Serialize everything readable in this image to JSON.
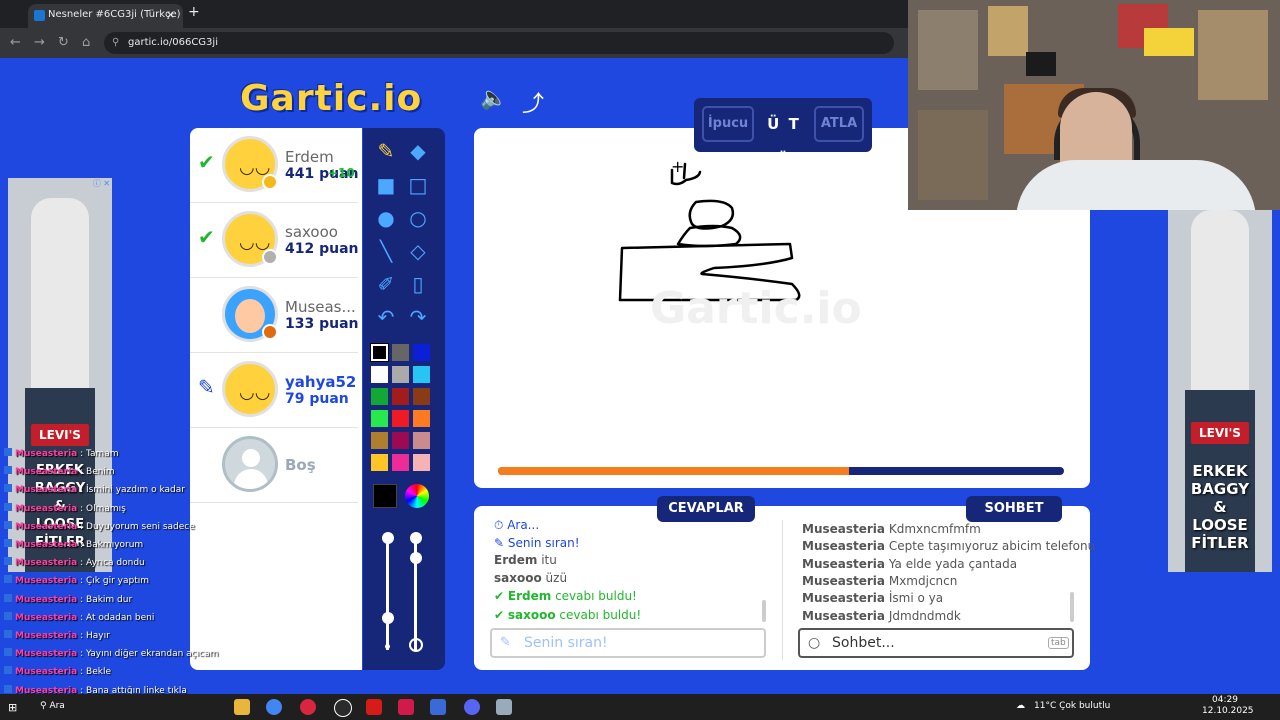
{
  "browser": {
    "tab_title": "Nesneler #6CG3ji (Türkçe)",
    "tab_close": "×",
    "new_tab": "+",
    "url": "gartic.io/066CG3ji",
    "nav": {
      "back": "←",
      "forward": "→",
      "reload": "↻",
      "home": "⌂",
      "lock": "⚲"
    }
  },
  "game": {
    "logo": "Gartic.io",
    "sound_icon": "🔈",
    "share_icon": "⤴",
    "hint": {
      "hint_label": "İpucu",
      "word": "Ü T Ü",
      "skip_label": "ATLA"
    },
    "watermark": "Gartic.io",
    "timer_progress": 0.62,
    "players": [
      {
        "name": "Erdem",
        "score": "441 puan",
        "bonus": "+10",
        "status": "check",
        "dot_color": "#f5b91a"
      },
      {
        "name": "saxooo",
        "score": "412 puan",
        "bonus": "",
        "status": "check",
        "dot_color": "#b0b0b0"
      },
      {
        "name": "Museas...",
        "score": "133 puan",
        "bonus": "",
        "status": "",
        "dot_color": "#e06a10"
      },
      {
        "name": "yahya52",
        "score": "79 puan",
        "bonus": "",
        "status": "drawing",
        "dot_color": ""
      },
      {
        "name": "Boş",
        "score": "",
        "bonus": "",
        "status": "empty",
        "dot_color": ""
      }
    ],
    "tools_icons": [
      "pencil-icon",
      "eraser-icon",
      "filled-rect-icon",
      "rect-icon",
      "filled-circle-icon",
      "circle-icon",
      "line-icon",
      "fill-bucket-icon",
      "eyedropper-icon",
      "page-icon",
      "undo-icon",
      "redo-icon"
    ],
    "palette": [
      "#000000",
      "#666666",
      "#0a1fd6",
      "#ffffff",
      "#aaaaaa",
      "#27c4f4",
      "#11a836",
      "#a31c1c",
      "#8a3a15",
      "#27e84c",
      "#ee1b24",
      "#ff7a21",
      "#b07f2e",
      "#9b0a53",
      "#c98b8b",
      "#ffc526",
      "#ed2c98",
      "#f7b2b5"
    ],
    "answers_tab": "CEVAPLAR",
    "chat_tab": "SOHBET",
    "answers": [
      {
        "user": "",
        "text": "Ara...",
        "type": "blue"
      },
      {
        "user": "",
        "text": "Senin sıran!",
        "type": "blue"
      },
      {
        "user": "Erdem",
        "text": "itu",
        "type": "normal"
      },
      {
        "user": "saxooo",
        "text": "üzü",
        "type": "normal"
      },
      {
        "user": "Erdem",
        "text": "cevabı buldu!",
        "type": "green"
      },
      {
        "user": "saxooo",
        "text": "cevabı buldu!",
        "type": "green"
      }
    ],
    "chat": [
      {
        "user": "Museasteria",
        "text": "Kdmxncmfmfm"
      },
      {
        "user": "Museasteria",
        "text": "Cepte taşımıyoruz abicim telefonu"
      },
      {
        "user": "Museasteria",
        "text": "Ya elde yada çantada"
      },
      {
        "user": "Museasteria",
        "text": "Mxmdjcncn"
      },
      {
        "user": "Museasteria",
        "text": "İsmi o ya"
      },
      {
        "user": "Museasteria",
        "text": "Jdmdndmdk"
      }
    ],
    "answer_placeholder": "Senin sıran!",
    "chat_placeholder": "Sohbet...",
    "tab_key": "tab"
  },
  "ads": {
    "brand": "LEVI'S",
    "copy": [
      "ERKEK",
      "BAGGY",
      "&",
      "LOOSE",
      "FİTLER"
    ],
    "info": "ⓘ ✕"
  },
  "stream_overlay": [
    {
      "user": "Museasteria",
      "text": "Tamam"
    },
    {
      "user": "Museasteria",
      "text": "Benim"
    },
    {
      "user": "Museasteria",
      "text": "İsmini yazdım o kadar"
    },
    {
      "user": "Museasteria",
      "text": "Olmamış"
    },
    {
      "user": "Museasteria",
      "text": "Duyuyorum seni sadece"
    },
    {
      "user": "Museasteria",
      "text": "Bakmıyorum"
    },
    {
      "user": "Museasteria",
      "text": "Ayrıca dondu"
    },
    {
      "user": "Museasteria",
      "text": "Çık gir yaptım"
    },
    {
      "user": "Museasteria",
      "text": "Bakim dur"
    },
    {
      "user": "Museasteria",
      "text": "At odadan beni"
    },
    {
      "user": "Museasteria",
      "text": "Hayır"
    },
    {
      "user": "Museasteria",
      "text": "Yayını diğer ekrandan açıcam"
    },
    {
      "user": "Museasteria",
      "text": "Bekle"
    },
    {
      "user": "Museasteria",
      "text": "Bana attığın linke tıkla"
    },
    {
      "user": "Museasteria",
      "text": "Başka odadasın"
    }
  ],
  "taskbar": {
    "search_label": "Ara",
    "weather": "11°C  Çok bulutlu",
    "time": "04:29",
    "date": "12.10.2025"
  }
}
